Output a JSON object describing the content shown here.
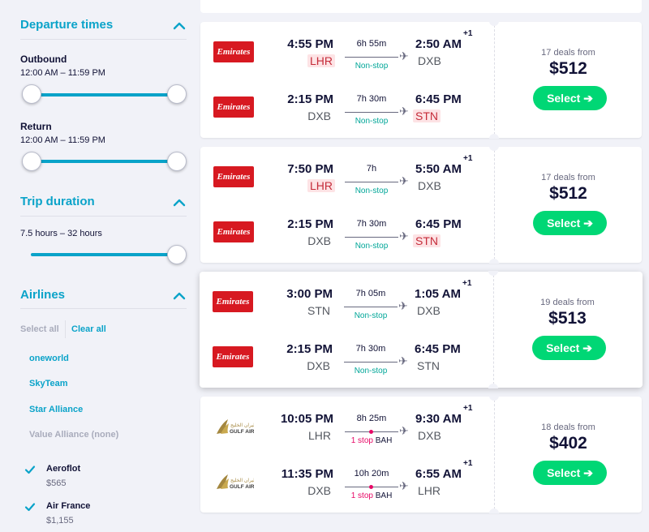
{
  "sidebar": {
    "departure_times": {
      "title": "Departure times",
      "outbound_label": "Outbound",
      "outbound_range": "12:00 AM – 11:59 PM",
      "return_label": "Return",
      "return_range": "12:00 AM – 11:59 PM"
    },
    "trip_duration": {
      "title": "Trip duration",
      "range": "7.5 hours – 32 hours"
    },
    "airlines": {
      "title": "Airlines",
      "select_all": "Select all",
      "clear_all": "Clear all",
      "alliances": [
        "oneworld",
        "SkyTeam",
        "Star Alliance",
        "Value Alliance (none)"
      ],
      "list": [
        {
          "name": "Aeroflot",
          "price": "$565",
          "checked": true
        },
        {
          "name": "Air France",
          "price": "$1,155",
          "checked": true
        }
      ]
    }
  },
  "results": [
    {
      "deals": "17 deals from",
      "price": "$512",
      "select_label": "Select ➔",
      "legs": [
        {
          "airline": "Emirates",
          "dep_time": "4:55 PM",
          "dep_code": "LHR",
          "duration": "6h 55m",
          "stops": "Non-stop",
          "arr_time": "2:50 AM",
          "arr_plus": "+1",
          "arr_code": "DXB"
        },
        {
          "airline": "Emirates",
          "dep_time": "2:15 PM",
          "dep_code": "DXB",
          "duration": "7h 30m",
          "stops": "Non-stop",
          "arr_time": "6:45 PM",
          "arr_plus": "",
          "arr_code": "STN"
        }
      ]
    },
    {
      "deals": "17 deals from",
      "price": "$512",
      "select_label": "Select ➔",
      "legs": [
        {
          "airline": "Emirates",
          "dep_time": "7:50 PM",
          "dep_code": "LHR",
          "duration": "7h",
          "stops": "Non-stop",
          "arr_time": "5:50 AM",
          "arr_plus": "+1",
          "arr_code": "DXB"
        },
        {
          "airline": "Emirates",
          "dep_time": "2:15 PM",
          "dep_code": "DXB",
          "duration": "7h 30m",
          "stops": "Non-stop",
          "arr_time": "6:45 PM",
          "arr_plus": "",
          "arr_code": "STN"
        }
      ]
    },
    {
      "deals": "19 deals from",
      "price": "$513",
      "select_label": "Select ➔",
      "legs": [
        {
          "airline": "Emirates",
          "dep_time": "3:00 PM",
          "dep_code": "STN",
          "duration": "7h 05m",
          "stops": "Non-stop",
          "arr_time": "1:05 AM",
          "arr_plus": "+1",
          "arr_code": "DXB"
        },
        {
          "airline": "Emirates",
          "dep_time": "2:15 PM",
          "dep_code": "DXB",
          "duration": "7h 30m",
          "stops": "Non-stop",
          "arr_time": "6:45 PM",
          "arr_plus": "",
          "arr_code": "STN"
        }
      ]
    },
    {
      "deals": "18 deals from",
      "price": "$402",
      "select_label": "Select ➔",
      "legs": [
        {
          "airline": "GULF AIR",
          "dep_time": "10:05 PM",
          "dep_code": "LHR",
          "duration": "8h 25m",
          "stops": "1 stop",
          "via": "BAH",
          "arr_time": "9:30 AM",
          "arr_plus": "+1",
          "arr_code": "DXB"
        },
        {
          "airline": "GULF AIR",
          "dep_time": "11:35 PM",
          "dep_code": "DXB",
          "duration": "10h 20m",
          "stops": "1 stop",
          "via": "BAH",
          "arr_time": "6:55 AM",
          "arr_plus": "+1",
          "arr_code": "LHR"
        }
      ]
    }
  ],
  "colors": {
    "accent": "#0aa3c9",
    "select": "#00d775",
    "nonstop": "#00a698",
    "stop": "#e70866",
    "emirates": "#d71921",
    "highlight_bg": "#fde3e5"
  }
}
